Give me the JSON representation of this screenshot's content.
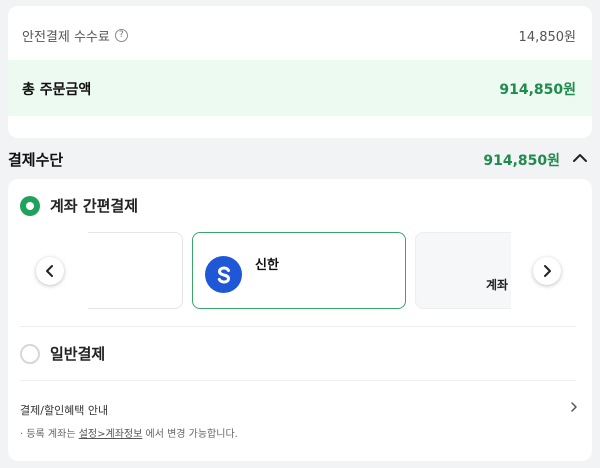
{
  "summary": {
    "fee_label": "안전결제 수수료",
    "fee_value": "14,850원",
    "total_label": "총 주문금액",
    "total_value": "914,850원"
  },
  "payment": {
    "title": "결제수단",
    "amount": "914,850원",
    "easy_pay_label": "계좌 간편결제",
    "selected_bank": "신한",
    "right_card_text": "계좌",
    "general_pay_label": "일반결제"
  },
  "benefits": {
    "label": "결제/할인혜택 안내",
    "note_prefix": "· 등록 계좌는 ",
    "note_link": "설정>계좌정보",
    "note_suffix": " 에서 변경 가능합니다."
  },
  "colors": {
    "accent_green": "#1f8b4c",
    "radio_green": "#1fa35c",
    "bank_blue": "#1f57d6",
    "total_bg": "#edfaf1"
  },
  "icons": {
    "info": "info-icon",
    "collapse": "chevron-up-icon",
    "prev": "chevron-left-icon",
    "next": "chevron-right-icon",
    "bank": "shinhan-logo-icon"
  }
}
